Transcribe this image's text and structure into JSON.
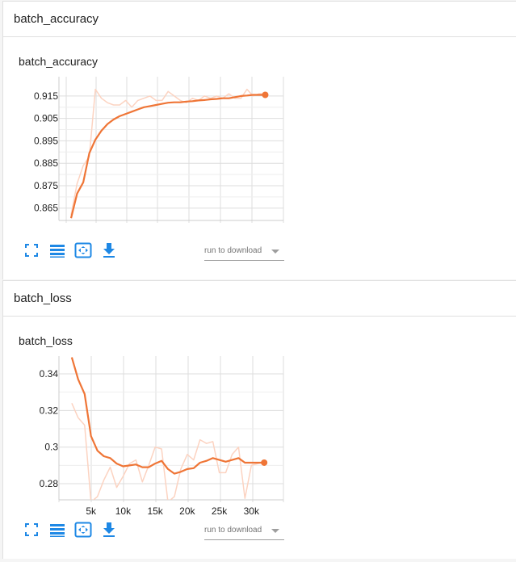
{
  "colors": {
    "accent": "#ef7536",
    "raw_line": "#fcd3c1",
    "grid": "#dddddd",
    "icon": "#1e88e5"
  },
  "sections": [
    {
      "header": "batch_accuracy",
      "card_title": "batch_accuracy",
      "download_label": "run to download"
    },
    {
      "header": "batch_loss",
      "card_title": "batch_loss",
      "download_label": "run to download"
    }
  ],
  "toolbar_icons": [
    "fullscreen-icon",
    "data-table-icon",
    "fit-domain-icon",
    "download-icon"
  ],
  "chart_data": [
    {
      "type": "line",
      "title": "batch_accuracy",
      "xlim": [
        -2000,
        35000
      ],
      "ylim": [
        0.8595,
        0.9236
      ],
      "x_ticks": [],
      "y_ticks": [
        0.865,
        0.875,
        0.885,
        0.895,
        0.905,
        0.915
      ],
      "y_tick_labels": [
        "0.865",
        "0.875",
        "0.885",
        "0.895",
        "0.905",
        "0.915"
      ],
      "grid": true,
      "series": [
        {
          "role": "raw",
          "x": [
            0,
            1000,
            2000,
            3000,
            4000,
            5000,
            6000,
            7000,
            8000,
            9000,
            10000,
            11000,
            12000,
            13000,
            14000,
            15000,
            16000,
            17000,
            18000,
            19000,
            20000,
            21000,
            22000,
            23000,
            24000,
            25000,
            26000,
            27000,
            28000,
            29000,
            30000,
            31000,
            32000
          ],
          "y": [
            0.862,
            0.876,
            0.884,
            0.888,
            0.918,
            0.914,
            0.912,
            0.911,
            0.911,
            0.913,
            0.91,
            0.913,
            0.914,
            0.915,
            0.913,
            0.913,
            0.917,
            0.915,
            0.913,
            0.912,
            0.914,
            0.913,
            0.915,
            0.914,
            0.915,
            0.914,
            0.916,
            0.914,
            0.914,
            0.918,
            0.915,
            0.916,
            0.916
          ]
        },
        {
          "role": "smoothed",
          "x": [
            0,
            1000,
            2000,
            3000,
            4000,
            5000,
            6000,
            7000,
            8000,
            9000,
            10000,
            11000,
            12000,
            13000,
            14000,
            15000,
            16000,
            17000,
            18000,
            19000,
            20000,
            21000,
            22000,
            23000,
            24000,
            25000,
            26000,
            27000,
            28000,
            29000,
            30000,
            31000,
            32000
          ],
          "y": [
            0.8605,
            0.8715,
            0.8765,
            0.8895,
            0.8955,
            0.8995,
            0.9025,
            0.9045,
            0.906,
            0.907,
            0.908,
            0.909,
            0.91,
            0.9105,
            0.911,
            0.9115,
            0.912,
            0.9122,
            0.9122,
            0.9125,
            0.9127,
            0.913,
            0.9132,
            0.9135,
            0.9137,
            0.914,
            0.914,
            0.9145,
            0.915,
            0.9152,
            0.9155,
            0.9155,
            0.9155
          ]
        }
      ]
    },
    {
      "type": "line",
      "title": "batch_loss",
      "xlim": [
        0,
        35000
      ],
      "ylim": [
        0.2712,
        0.3497
      ],
      "x_ticks": [
        5000,
        10000,
        15000,
        20000,
        25000,
        30000
      ],
      "x_tick_labels": [
        "5k",
        "10k",
        "15k",
        "20k",
        "25k",
        "30k"
      ],
      "y_ticks": [
        0.28,
        0.3,
        0.32,
        0.34
      ],
      "y_tick_labels": [
        "0.28",
        "0.3",
        "0.32",
        "0.34"
      ],
      "grid": true,
      "series": [
        {
          "role": "raw",
          "x": [
            2000,
            3000,
            4000,
            5000,
            6000,
            7000,
            8000,
            9000,
            10000,
            11000,
            12000,
            13000,
            14000,
            15000,
            16000,
            17000,
            18000,
            19000,
            20000,
            21000,
            22000,
            23000,
            24000,
            25000,
            26000,
            27000,
            28000,
            29000,
            30000,
            31000,
            32000
          ],
          "y": [
            0.324,
            0.316,
            0.312,
            0.27,
            0.273,
            0.282,
            0.289,
            0.278,
            0.284,
            0.291,
            0.293,
            0.281,
            0.29,
            0.3,
            0.299,
            0.27,
            0.273,
            0.288,
            0.296,
            0.293,
            0.304,
            0.302,
            0.303,
            0.286,
            0.286,
            0.296,
            0.3,
            0.272,
            0.29,
            0.291,
            0.292
          ]
        },
        {
          "role": "smoothed",
          "x": [
            2000,
            3000,
            4000,
            5000,
            6000,
            7000,
            8000,
            9000,
            10000,
            11000,
            12000,
            13000,
            14000,
            15000,
            16000,
            17000,
            18000,
            19000,
            20000,
            21000,
            22000,
            23000,
            24000,
            25000,
            26000,
            27000,
            28000,
            29000,
            30000,
            31000,
            32000
          ],
          "y": [
            0.349,
            0.337,
            0.329,
            0.306,
            0.298,
            0.295,
            0.294,
            0.291,
            0.2895,
            0.29,
            0.2905,
            0.289,
            0.289,
            0.291,
            0.2925,
            0.288,
            0.2855,
            0.2865,
            0.288,
            0.2885,
            0.2915,
            0.2925,
            0.294,
            0.293,
            0.292,
            0.293,
            0.294,
            0.2915,
            0.2915,
            0.2915,
            0.2915
          ]
        }
      ]
    }
  ]
}
